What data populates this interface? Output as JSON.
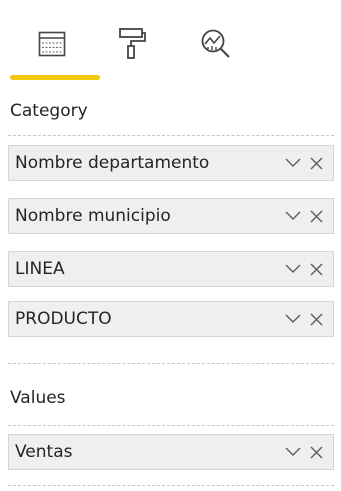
{
  "tabs": {
    "fields_icon": "fields-grid-icon",
    "format_icon": "paint-roller-icon",
    "analytics_icon": "analytics-magnifier-icon",
    "active_indicator_color": "#f2c811"
  },
  "category": {
    "label": "Category",
    "fields": [
      {
        "name": "Nombre departamento"
      },
      {
        "name": "Nombre municipio"
      },
      {
        "name": "LINEA"
      },
      {
        "name": "PRODUCTO"
      }
    ]
  },
  "values": {
    "label": "Values",
    "fields": [
      {
        "name": "Ventas"
      }
    ]
  }
}
